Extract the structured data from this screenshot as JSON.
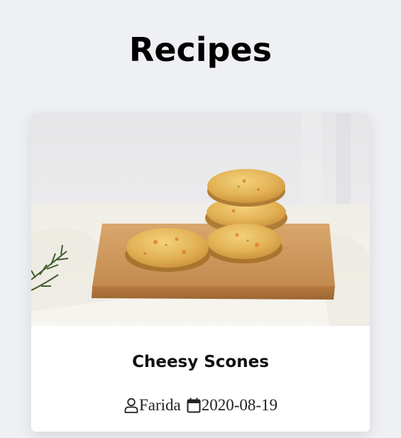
{
  "page": {
    "title": "Recipes"
  },
  "recipe_card": {
    "image_subject": "cheesy scones on a wooden board",
    "title": "Cheesy Scones",
    "author": "Farida",
    "date": "2020-08-19",
    "author_icon": "user-icon",
    "date_icon": "calendar-icon"
  },
  "colors": {
    "page_background": "#eef0f3",
    "card_background": "#ffffff",
    "text": "#000000"
  }
}
